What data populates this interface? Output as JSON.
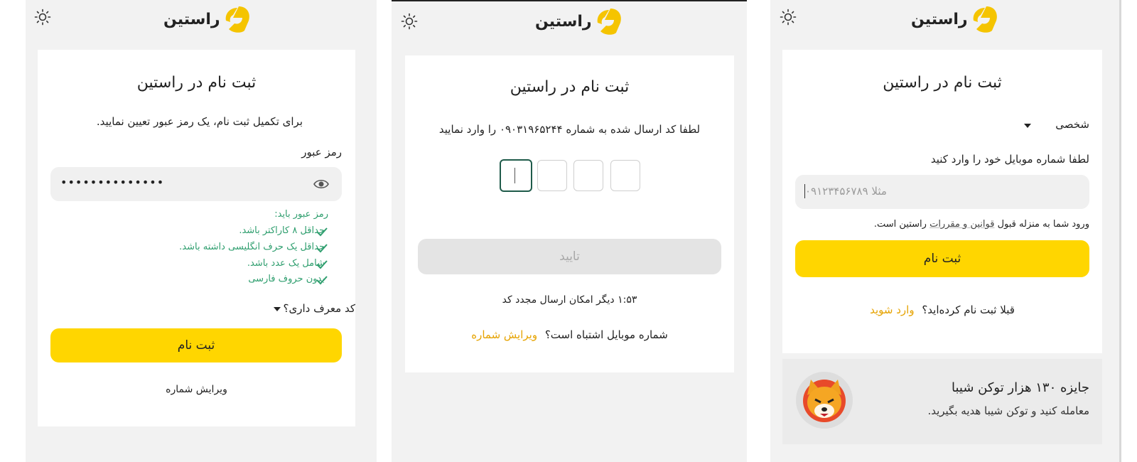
{
  "brand": {
    "name": "راستین",
    "accent": "#ffd600",
    "link_color": "#e6a300",
    "success_color": "#2e9e6e"
  },
  "screen_password": {
    "title": "ثبت نام در راستین",
    "subtitle": "برای تکمیل ثبت نام، یک رمز عبور تعیین نمایید.",
    "password_label": "رمز عبور",
    "password_value": "••••••••••••••",
    "rules_title": "رمز عبور باید:",
    "rules": [
      "حداقل ۸ کاراکتر باشد.",
      "حداقل یک حرف انگلیسی داشته باشد.",
      "شامل یک عدد باشد.",
      "بدون حروف فارسی"
    ],
    "referral_label": "کد معرف داری؟",
    "submit_label": "ثبت نام",
    "edit_number_label": "ویرایش شماره"
  },
  "screen_otp": {
    "title": "ثبت نام در راستین",
    "prompt": "لطفا کد ارسال شده به شماره ۰۹۰۳۱۹۶۵۲۴۴ را وارد نمایید",
    "confirm_label": "تایید",
    "resend_text": "۱:۵۳ دیگر امکان ارسال مجدد کد",
    "wrong_number_text": "شماره موبایل اشتباه است؟",
    "edit_number_link": "ویرایش شماره"
  },
  "screen_signup": {
    "title": "ثبت نام در راستین",
    "account_type": "شخصی",
    "phone_label": "لطفا شماره موبایل خود را وارد کنید",
    "phone_placeholder": "مثلا ۰۹۱۲۳۴۵۶۷۸۹",
    "terms_prefix": "ورود شما به منزله قبول",
    "terms_link": "قوانین و مقررات",
    "terms_suffix": "راستین است.",
    "submit_label": "ثبت نام",
    "already_text": "قبلا ثبت نام کرده‌اید؟",
    "login_link": "وارد شوید",
    "promo_title": "جایزه ۱۳۰ هزار توکن شیبا",
    "promo_subtitle": "معامله کنید و توکن شیبا هدیه بگیرید."
  }
}
